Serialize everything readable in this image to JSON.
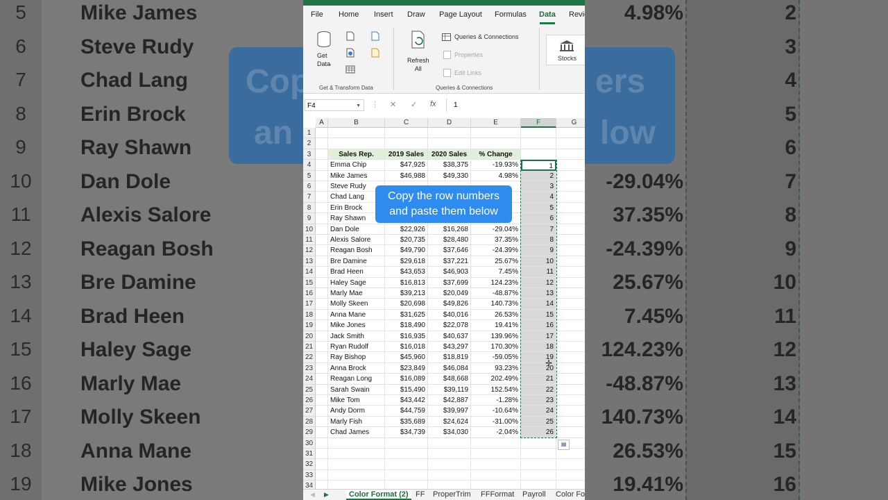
{
  "background_zoom": {
    "rows": [
      {
        "num": "5",
        "name": "Mike James",
        "pct": "4.98%",
        "f": "2"
      },
      {
        "num": "6",
        "name": "Steve Rudy",
        "pct": "",
        "f": "3"
      },
      {
        "num": "7",
        "name": "Chad Lang",
        "pct": "",
        "f": "4"
      },
      {
        "num": "8",
        "name": "Erin Brock",
        "pct": "",
        "f": "5"
      },
      {
        "num": "9",
        "name": "Ray Shawn",
        "pct": "",
        "f": "6"
      },
      {
        "num": "10",
        "name": "Dan Dole",
        "pct": "-29.04%",
        "f": "7"
      },
      {
        "num": "11",
        "name": "Alexis Salore",
        "pct": "37.35%",
        "f": "8"
      },
      {
        "num": "12",
        "name": "Reagan Bosh",
        "pct": "-24.39%",
        "f": "9"
      },
      {
        "num": "13",
        "name": "Bre Damine",
        "pct": "25.67%",
        "f": "10"
      },
      {
        "num": "14",
        "name": "Brad Heen",
        "pct": "7.45%",
        "f": "11"
      },
      {
        "num": "15",
        "name": "Haley Sage",
        "pct": "124.23%",
        "f": "12"
      },
      {
        "num": "16",
        "name": "Marly Mae",
        "pct": "-48.87%",
        "f": "13"
      },
      {
        "num": "17",
        "name": "Molly Skeen",
        "pct": "140.73%",
        "f": "14"
      },
      {
        "num": "18",
        "name": "Anna Mane",
        "pct": "26.53%",
        "f": "15"
      },
      {
        "num": "19",
        "name": "Mike Jones",
        "pct": "19.41%",
        "f": "16"
      }
    ],
    "banner_fragments": [
      "Cop",
      "an",
      "ers",
      "low"
    ]
  },
  "ribbon": {
    "tabs": [
      "File",
      "Home",
      "Insert",
      "Draw",
      "Page Layout",
      "Formulas",
      "Data",
      "Revie"
    ],
    "active_tab": "Data",
    "get_data_label": "Get\nData",
    "group1_label": "Get & Transform Data",
    "refresh_label": "Refresh\nAll",
    "queries_connections": "Queries & Connections",
    "properties": "Properties",
    "edit_links": "Edit Links",
    "group2_label": "Queries & Connections",
    "stocks_label": "Stocks"
  },
  "formula_bar": {
    "name_box": "F4",
    "value": "1",
    "fx": "fx"
  },
  "columns": [
    "A",
    "B",
    "C",
    "D",
    "E",
    "F",
    "G"
  ],
  "selected_column": "F",
  "row_numbers": [
    "1",
    "2",
    "3",
    "4",
    "5",
    "6",
    "7",
    "8",
    "9",
    "10",
    "11",
    "12",
    "13",
    "14",
    "15",
    "16",
    "17",
    "18",
    "19",
    "20",
    "21",
    "22",
    "23",
    "24",
    "25",
    "26",
    "27",
    "28",
    "29",
    "30",
    "31",
    "32",
    "33",
    "34"
  ],
  "headers": {
    "b": "Sales Rep.",
    "c": "2019 Sales",
    "d": "2020 Sales",
    "e": "% Change"
  },
  "data_rows": [
    {
      "b": "Emma Chip",
      "c": "$47,925",
      "d": "$38,375",
      "e": "-19.93%",
      "f": "1"
    },
    {
      "b": "Mike James",
      "c": "$46,988",
      "d": "$49,330",
      "e": "4.98%",
      "f": "2"
    },
    {
      "b": "Steve Rudy",
      "c": "",
      "d": "",
      "e": "",
      "f": "3"
    },
    {
      "b": "Chad Lang",
      "c": "",
      "d": "",
      "e": "",
      "f": "4"
    },
    {
      "b": "Erin Brock",
      "c": "",
      "d": "",
      "e": "",
      "f": "5"
    },
    {
      "b": "Ray Shawn",
      "c": "",
      "d": "",
      "e": "",
      "f": "6"
    },
    {
      "b": "Dan Dole",
      "c": "$22,926",
      "d": "$16,268",
      "e": "-29.04%",
      "f": "7"
    },
    {
      "b": "Alexis Salore",
      "c": "$20,735",
      "d": "$28,480",
      "e": "37.35%",
      "f": "8"
    },
    {
      "b": "Reagan Bosh",
      "c": "$49,790",
      "d": "$37,646",
      "e": "-24.39%",
      "f": "9"
    },
    {
      "b": "Bre Damine",
      "c": "$29,618",
      "d": "$37,221",
      "e": "25.67%",
      "f": "10"
    },
    {
      "b": "Brad Heen",
      "c": "$43,653",
      "d": "$46,903",
      "e": "7.45%",
      "f": "11"
    },
    {
      "b": "Haley Sage",
      "c": "$16,813",
      "d": "$37,699",
      "e": "124.23%",
      "f": "12"
    },
    {
      "b": "Marly Mae",
      "c": "$39,213",
      "d": "$20,049",
      "e": "-48.87%",
      "f": "13"
    },
    {
      "b": "Molly Skeen",
      "c": "$20,698",
      "d": "$49,826",
      "e": "140.73%",
      "f": "14"
    },
    {
      "b": "Anna Mane",
      "c": "$31,625",
      "d": "$40,016",
      "e": "26.53%",
      "f": "15"
    },
    {
      "b": "Mike Jones",
      "c": "$18,490",
      "d": "$22,078",
      "e": "19.41%",
      "f": "16"
    },
    {
      "b": "Jack Smith",
      "c": "$16,935",
      "d": "$40,637",
      "e": "139.96%",
      "f": "17"
    },
    {
      "b": "Ryan Rudolf",
      "c": "$16,018",
      "d": "$43,297",
      "e": "170.30%",
      "f": "18"
    },
    {
      "b": "Ray Bishop",
      "c": "$45,960",
      "d": "$18,819",
      "e": "-59.05%",
      "f": "19"
    },
    {
      "b": "Anna Brock",
      "c": "$23,849",
      "d": "$46,084",
      "e": "93.23%",
      "f": "20"
    },
    {
      "b": "Reagan Long",
      "c": "$16,089",
      "d": "$48,668",
      "e": "202.49%",
      "f": "21"
    },
    {
      "b": "Sarah Swain",
      "c": "$15,490",
      "d": "$39,119",
      "e": "152.54%",
      "f": "22"
    },
    {
      "b": "Mike Tom",
      "c": "$43,442",
      "d": "$42,887",
      "e": "-1.28%",
      "f": "23"
    },
    {
      "b": "Andy Dorm",
      "c": "$44,759",
      "d": "$39,997",
      "e": "-10.64%",
      "f": "24"
    },
    {
      "b": "Marly Fish",
      "c": "$35,689",
      "d": "$24,624",
      "e": "-31.00%",
      "f": "25"
    },
    {
      "b": "Chad James",
      "c": "$34,739",
      "d": "$34,030",
      "e": "-2.04%",
      "f": "26"
    }
  ],
  "sheet_tabs": [
    "Color Format (2)",
    "FF",
    "ProperTrim",
    "FFFormat",
    "Payroll",
    "Color For"
  ],
  "active_sheet": "Color Format (2)",
  "caption": {
    "line1": "Copy the row numbers",
    "line2": "and paste them below"
  },
  "colors": {
    "excel_green": "#217346",
    "caption_blue": "#2e8cf0",
    "header_fill": "#e2efd9",
    "selection_fill": "#d9d9d9"
  }
}
